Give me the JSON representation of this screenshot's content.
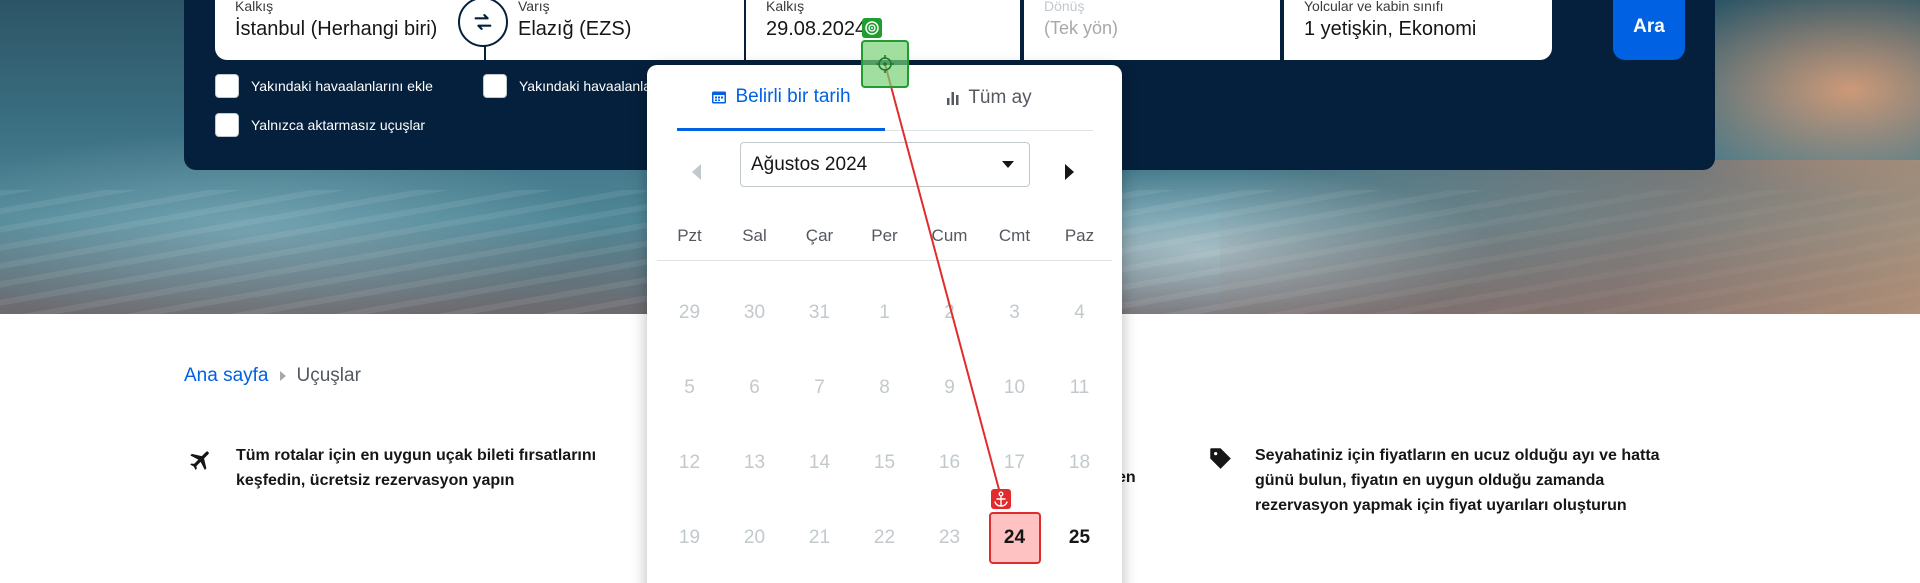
{
  "search": {
    "origin": {
      "label": "Kalkış",
      "value": "İstanbul (Herhangi biri)"
    },
    "destination": {
      "label": "Varış",
      "value": "Elazığ (EZS)"
    },
    "depart": {
      "label": "Kalkış",
      "value": "29.08.2024"
    },
    "return": {
      "label": "Dönüş",
      "placeholder": "(Tek yön)"
    },
    "passengers": {
      "label": "Yolcular ve kabin sınıfı",
      "value": "1 yetişkin, Ekonomi"
    },
    "search_button": "Ara",
    "checkbox_nearby_origin": "Yakındaki havaalanlarını ekle",
    "checkbox_nearby_dest": "Yakındaki havaalanla",
    "checkbox_direct": "Yalnızca aktarmasız uçuşlar"
  },
  "datepicker": {
    "tab_specific": "Belirli bir tarih",
    "tab_whole_month": "Tüm ay",
    "month_label": "Ağustos 2024",
    "weekdays": [
      "Pzt",
      "Sal",
      "Çar",
      "Per",
      "Cum",
      "Cmt",
      "Paz"
    ],
    "days": [
      {
        "d": "29",
        "state": "disabled"
      },
      {
        "d": "30",
        "state": "disabled"
      },
      {
        "d": "31",
        "state": "disabled"
      },
      {
        "d": "1",
        "state": "disabled"
      },
      {
        "d": "2",
        "state": "disabled"
      },
      {
        "d": "3",
        "state": "disabled"
      },
      {
        "d": "4",
        "state": "disabled"
      },
      {
        "d": "5",
        "state": "disabled"
      },
      {
        "d": "6",
        "state": "disabled"
      },
      {
        "d": "7",
        "state": "disabled"
      },
      {
        "d": "8",
        "state": "disabled"
      },
      {
        "d": "9",
        "state": "disabled"
      },
      {
        "d": "10",
        "state": "disabled"
      },
      {
        "d": "11",
        "state": "disabled"
      },
      {
        "d": "12",
        "state": "disabled"
      },
      {
        "d": "13",
        "state": "disabled"
      },
      {
        "d": "14",
        "state": "disabled"
      },
      {
        "d": "15",
        "state": "disabled"
      },
      {
        "d": "16",
        "state": "disabled"
      },
      {
        "d": "17",
        "state": "disabled"
      },
      {
        "d": "18",
        "state": "disabled"
      },
      {
        "d": "19",
        "state": "disabled"
      },
      {
        "d": "20",
        "state": "disabled"
      },
      {
        "d": "21",
        "state": "disabled"
      },
      {
        "d": "22",
        "state": "disabled"
      },
      {
        "d": "23",
        "state": "disabled"
      },
      {
        "d": "24",
        "state": "selected"
      },
      {
        "d": "25",
        "state": "available"
      }
    ]
  },
  "breadcrumb": {
    "home": "Ana sayfa",
    "current": "Uçuşlar"
  },
  "features": {
    "routes_text": "Tüm rotalar için en uygun uçak bileti fırsatlarını keşfedin, ücretsiz rezervasyon yapın",
    "middle_tail": "en",
    "alerts_text": "Seyahatiniz için fiyatların en ucuz olduğu ayı ve hatta günü bulun, fiyatın en uygun olduğu zamanda rezervasyon yapmak için fiyat uyarıları oluşturun"
  },
  "colors": {
    "panel": "#05203c",
    "accent": "#0062e3",
    "annotation_start": "#1f9d2f",
    "annotation_end": "#e02c2c"
  },
  "icons": {
    "swap": "swap-arrows-icon",
    "calendar": "calendar-icon",
    "bar_chart": "bar-chart-icon",
    "plane": "plane-icon",
    "tag": "price-tag-icon"
  }
}
